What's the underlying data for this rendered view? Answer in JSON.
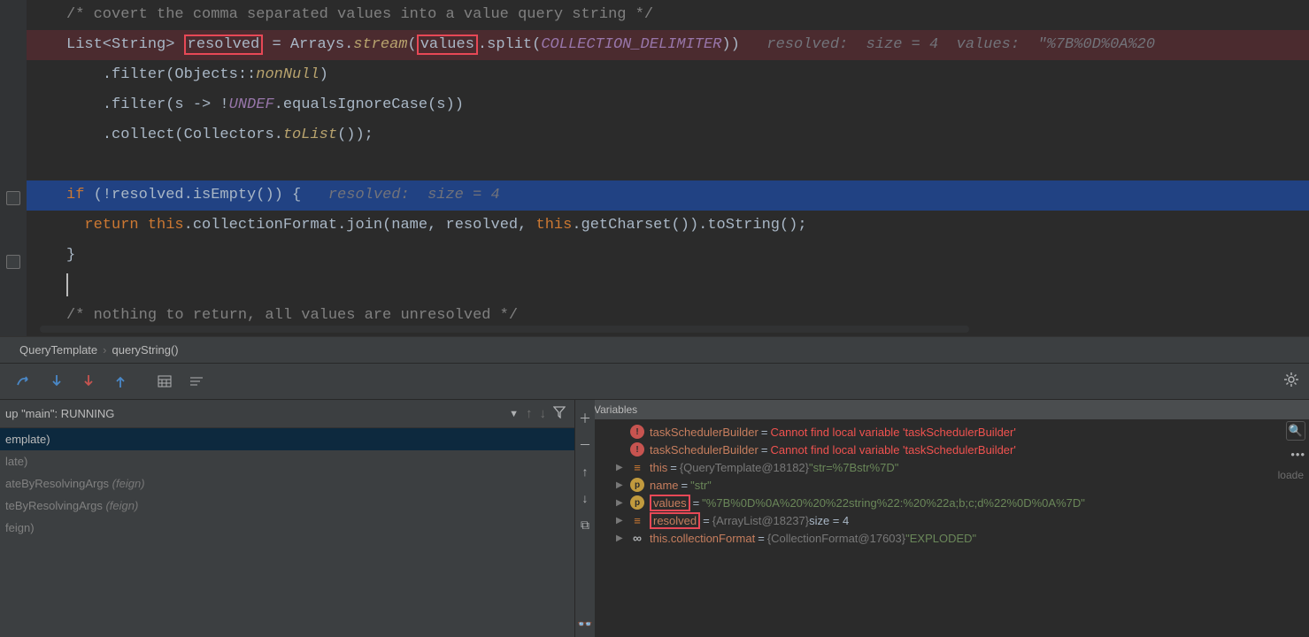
{
  "code": {
    "line1_comment": "/* covert the comma separated values into a value query string */",
    "line2a": "List<String>",
    "line2_resolved": "resolved",
    "line2b": "= Arrays.",
    "line2_stream": "stream",
    "line2c": "(",
    "line2_values": "values",
    "line2d": ".split(",
    "line2_const": "COLLECTION_DELIMITER",
    "line2e": "))",
    "line2_hint": "resolved:  size = 4  values:  \"%7B%0D%0A%20",
    "line3a": ".filter(Objects::",
    "line3b": "nonNull",
    "line3c": ")",
    "line4a": ".filter(s -> !",
    "line4_undef": "UNDEF",
    "line4b": ".equalsIgnoreCase(s))",
    "line5a": ".collect(Collectors.",
    "line5b": "toList",
    "line5c": "());",
    "line7_if": "if",
    "line7a": " (!resolved.isEmpty()) {",
    "line7_hint": "resolved:  size = 4",
    "line8_return": "return",
    "line8_this": "this",
    "line8a": ".collectionFormat.join(name, resolved, ",
    "line8_this2": "this",
    "line8b": ".getCharset()).toString();",
    "line9": "}",
    "line11_comment": "/* nothing to return, all values are unresolved */"
  },
  "breadcrumb": {
    "item1": "QueryTemplate",
    "item2": "queryString()"
  },
  "frames": {
    "thread": "up \"main\": RUNNING",
    "items": [
      {
        "main": "emplate)",
        "pkg": "",
        "selected": true
      },
      {
        "main": "late)",
        "pkg": ""
      },
      {
        "main": "ateByResolvingArgs",
        "pkg": " (feign)"
      },
      {
        "main": "teByResolvingArgs",
        "pkg": " (feign)"
      },
      {
        "main": "feign)",
        "pkg": ""
      }
    ]
  },
  "variables": {
    "title": "Variables",
    "rows": [
      {
        "type": "err",
        "name": "taskSchedulerBuilder",
        "err": "Cannot find local variable 'taskSchedulerBuilder'"
      },
      {
        "type": "err",
        "name": "taskSchedulerBuilder",
        "err": "Cannot find local variable 'taskSchedulerBuilder'"
      },
      {
        "type": "obj",
        "icon": "cell",
        "arrow": true,
        "name": "this",
        "objref": "{QueryTemplate@18182}",
        "str": "\"str=%7Bstr%7D\""
      },
      {
        "type": "str",
        "icon": "param",
        "arrow": true,
        "name": "name",
        "str": "\"str\""
      },
      {
        "type": "str",
        "icon": "param",
        "arrow": true,
        "boxed": true,
        "name": "values",
        "str": "\"%7B%0D%0A%20%20%22string%22:%20%22a;b;c;d%22%0D%0A%7D\""
      },
      {
        "type": "obj",
        "icon": "cell",
        "arrow": true,
        "boxed": true,
        "name": "resolved",
        "objref": "{ArrayList@18237}",
        "plain": " size = 4"
      },
      {
        "type": "obj",
        "icon": "infinity",
        "arrow": true,
        "name": "this.collectionFormat",
        "objref": "{CollectionFormat@17603}",
        "str": "\"EXPLODED\""
      }
    ],
    "right_label": "loade"
  }
}
